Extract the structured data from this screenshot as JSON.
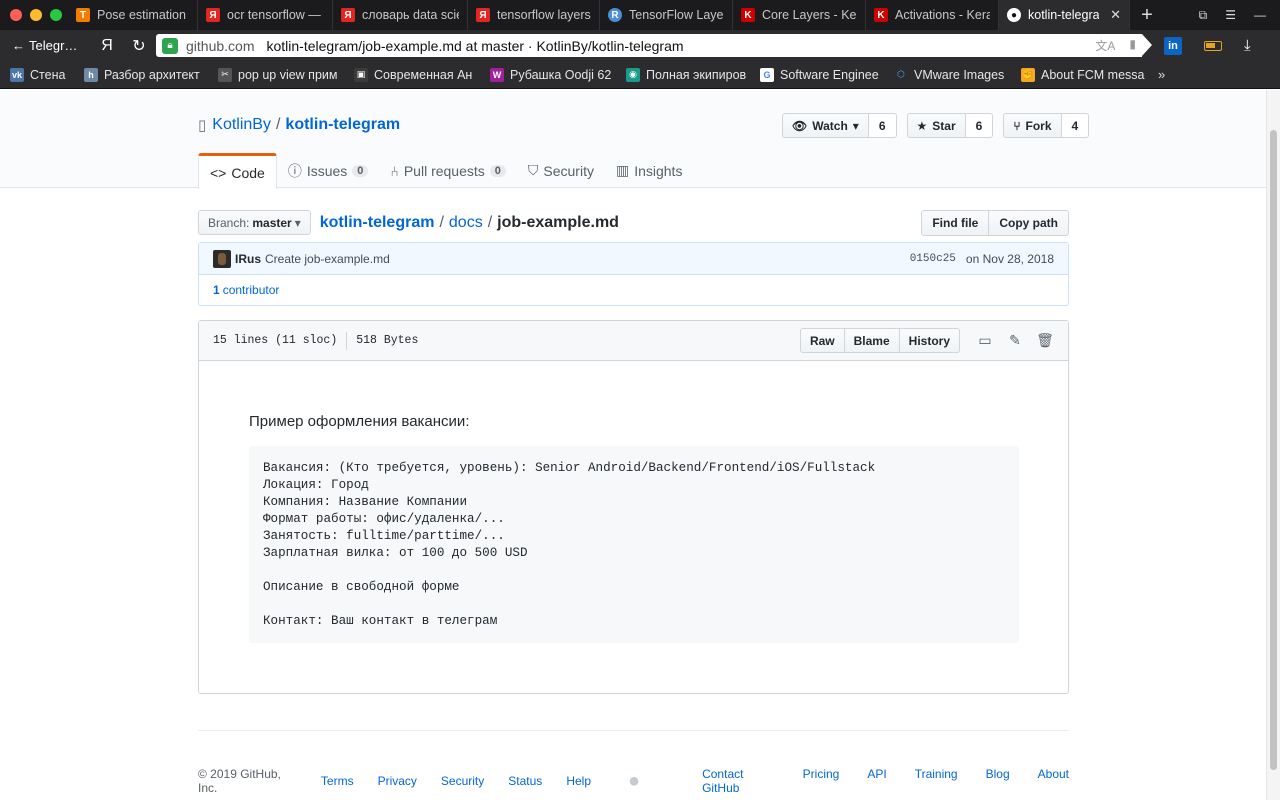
{
  "browser": {
    "tabs": [
      {
        "label": "Pose estimation",
        "fav": "T",
        "color": "#f57c00"
      },
      {
        "label": "ocr tensorflow —",
        "fav": "Я",
        "color": "#e52620"
      },
      {
        "label": "словарь data scie",
        "fav": "Я",
        "color": "#e52620"
      },
      {
        "label": "tensorflow layers",
        "fav": "Я",
        "color": "#e52620"
      },
      {
        "label": "TensorFlow Layer",
        "fav": "R",
        "color": "#4a8fd8"
      },
      {
        "label": "Core Layers - Ker",
        "fav": "K",
        "color": "#d00000"
      },
      {
        "label": "Activations - Kera",
        "fav": "K",
        "color": "#d00000"
      },
      {
        "label": "kotlin-telegram",
        "fav": "●",
        "color": "#333333"
      }
    ],
    "back_label": "Telegr…",
    "yandex_logo": "Я",
    "domain": "github.com",
    "page_title": "kotlin-telegram/job-example.md at master · KotlinBy/kotlin-telegram",
    "bookmarks": [
      {
        "label": "Стена",
        "fav": "vk",
        "color": "#4a76a8"
      },
      {
        "label": "Разбор архитект",
        "fav": "h",
        "color": "#6e8aa4"
      },
      {
        "label": "pop up view прим",
        "fav": "✂",
        "color": "#555555"
      },
      {
        "label": "Современная Ан",
        "fav": "▣",
        "color": "#3b3b3b"
      },
      {
        "label": "Рубашка Oodji 62",
        "fav": "W",
        "color": "#a020a0"
      },
      {
        "label": "Полная экипиров",
        "fav": "◉",
        "color": "#1a9c8c"
      },
      {
        "label": "Software Enginee",
        "fav": "G",
        "color": "#ffffff"
      },
      {
        "label": "VMware Images",
        "fav": "⬡",
        "color": "#2c2c2e"
      },
      {
        "label": "About FCM messa",
        "fav": "✊",
        "color": "#f5a623"
      }
    ],
    "bookmarks_more": "»",
    "linkedin_label": "in"
  },
  "repo": {
    "owner": "KotlinBy",
    "name": "kotlin-telegram",
    "watch_label": "Watch",
    "watch_count": "6",
    "star_label": "Star",
    "star_count": "6",
    "fork_label": "Fork",
    "fork_count": "4",
    "nav": {
      "code": "Code",
      "issues": "Issues",
      "issues_count": "0",
      "pulls": "Pull requests",
      "pulls_count": "0",
      "security": "Security",
      "insights": "Insights"
    }
  },
  "file_nav": {
    "branch_label": "Branch:",
    "branch_value": "master",
    "crumb_root": "kotlin-telegram",
    "crumb_dir": "docs",
    "crumb_file": "job-example.md",
    "find_file": "Find file",
    "copy_path": "Copy path"
  },
  "commit": {
    "author": "IRus",
    "message": "Create job-example.md",
    "sha": "0150c25",
    "date": "on Nov 28, 2018",
    "contributors_count": "1",
    "contributors_label": "contributor"
  },
  "file": {
    "lines": "15 lines (11 sloc)",
    "size": "518 Bytes",
    "raw": "Raw",
    "blame": "Blame",
    "history": "History",
    "intro": "Пример оформления вакансии:",
    "code": "Вакансия: (Кто требуется, уровень): Senior Android/Backend/Frontend/iOS/Fullstack\nЛокация: Город\nКомпания: Название Компании\nФормат работы: офис/удаленка/...\nЗанятость: fulltime/parttime/...\nЗарплатная вилка: от 100 до 500 USD\n\nОписание в свободной форме\n\nКонтакт: Ваш контакт в телеграм"
  },
  "footer": {
    "copyright": "© 2019 GitHub, Inc.",
    "left_links": [
      "Terms",
      "Privacy",
      "Security",
      "Status",
      "Help"
    ],
    "right_links": [
      "Contact GitHub",
      "Pricing",
      "API",
      "Training",
      "Blog",
      "About"
    ]
  }
}
